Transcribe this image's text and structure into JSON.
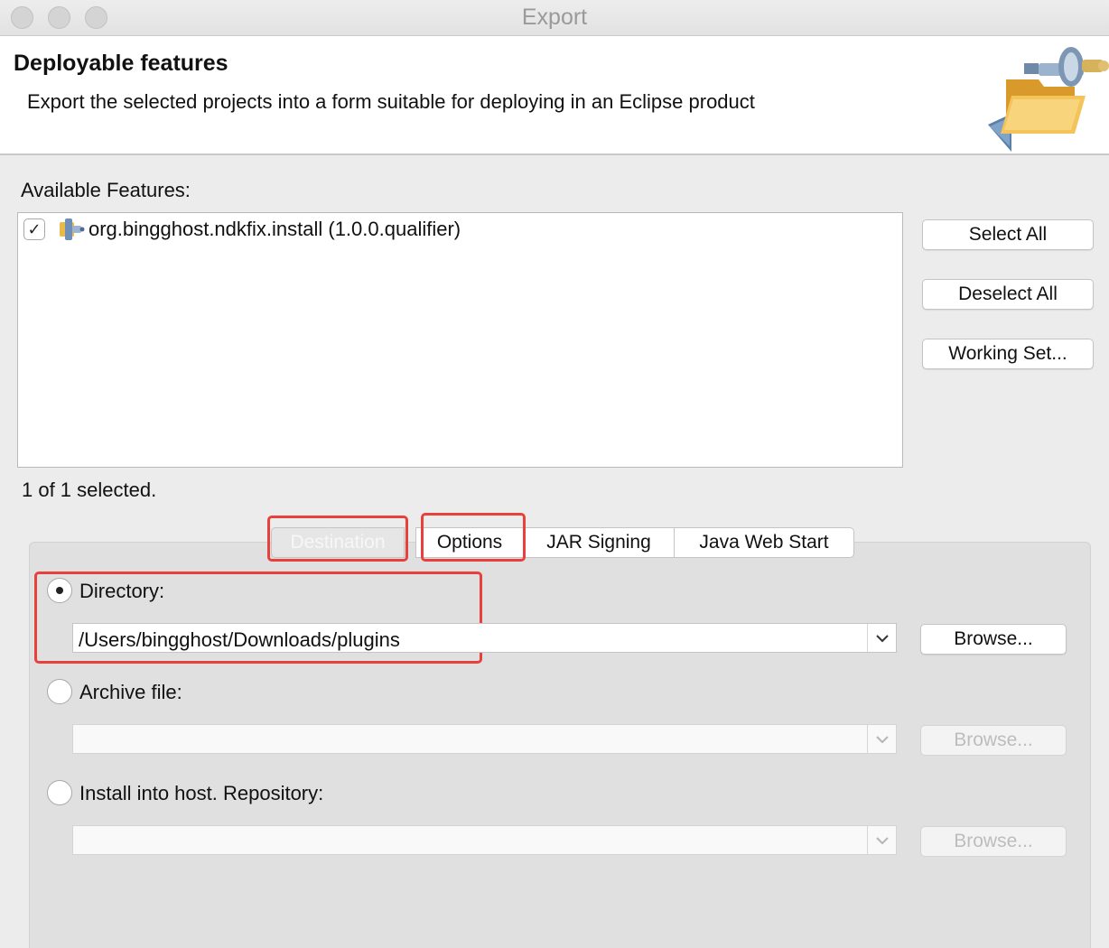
{
  "window": {
    "title": "Export"
  },
  "header": {
    "title": "Deployable features",
    "description": "Export the selected projects into a form suitable for deploying in an Eclipse product",
    "art_icon": "folder-export-icon"
  },
  "features": {
    "label": "Available Features:",
    "items": [
      {
        "checked": true,
        "check_glyph": "✓",
        "icon": "feature-plug-icon",
        "label": "org.bingghost.ndkfix.install (1.0.0.qualifier)"
      }
    ],
    "selection_status": "1 of 1 selected."
  },
  "buttons": {
    "select_all": "Select All",
    "deselect_all": "Deselect All",
    "working_set": "Working Set..."
  },
  "tabs": [
    {
      "label": "Destination",
      "selected": true
    },
    {
      "label": "Options",
      "selected": false
    },
    {
      "label": "JAR Signing",
      "selected": false
    },
    {
      "label": "Java Web Start",
      "selected": false
    }
  ],
  "destination": {
    "directory": {
      "label": "Directory:",
      "selected": true,
      "value": "/Users/bingghost/Downloads/plugins",
      "browse_label": "Browse..."
    },
    "archive": {
      "label": "Archive file:",
      "selected": false,
      "value": "",
      "browse_label": "Browse..."
    },
    "install": {
      "label": "Install into host. Repository:",
      "selected": false,
      "value": "",
      "browse_label": "Browse..."
    }
  },
  "colors": {
    "highlight": "#e8403a",
    "panel": "#e0e0e0"
  }
}
